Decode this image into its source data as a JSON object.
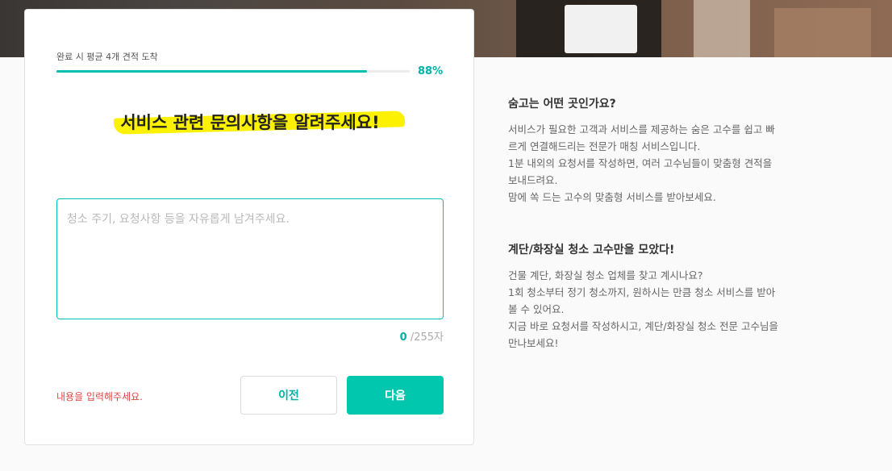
{
  "progress": {
    "label": "완료 시 평균 4개 견적 도착",
    "percent_text": "88%",
    "fraction": 0.88
  },
  "question": {
    "title": "서비스 관련 문의사항을 알려주세요!"
  },
  "textarea": {
    "value": "",
    "placeholder": "청소 주기, 요청사항 등을 자유롭게 남겨주세요."
  },
  "counter": {
    "current": "0",
    "max_text": " /255자"
  },
  "error": {
    "text": "내용을 입력해주세요."
  },
  "buttons": {
    "prev_label": "이전",
    "next_label": "다음"
  },
  "info": {
    "sections": [
      {
        "title": "숨고는 어떤 곳인가요?",
        "body": "서비스가 필요한 고객과 서비스를 제공하는 숨은 고수를 쉽고 빠\n르게 연결해드리는 전문가 매칭 서비스입니다.\n1분 내외의 요청서를 작성하면, 여러 고수님들이 맞춤형 견적을\n보내드려요.\n맘에 쏙 드는 고수의 맞춤형 서비스를 받아보세요."
      },
      {
        "title": "계단/화장실 청소 고수만을 모았다!",
        "body": "건물 계단, 화장실 청소 업체를 찾고 계시나요?\n1회 청소부터 정기 청소까지, 원하시는 만큼 청소 서비스를 받아\n볼 수 있어요.\n지금 바로 요청서를 작성하시고, 계단/화장실 청소 전문 고수님을\n만나보세요!"
      }
    ]
  },
  "colors": {
    "accent": "#00c7ae",
    "highlight": "#fcf200",
    "error": "#e04545"
  }
}
